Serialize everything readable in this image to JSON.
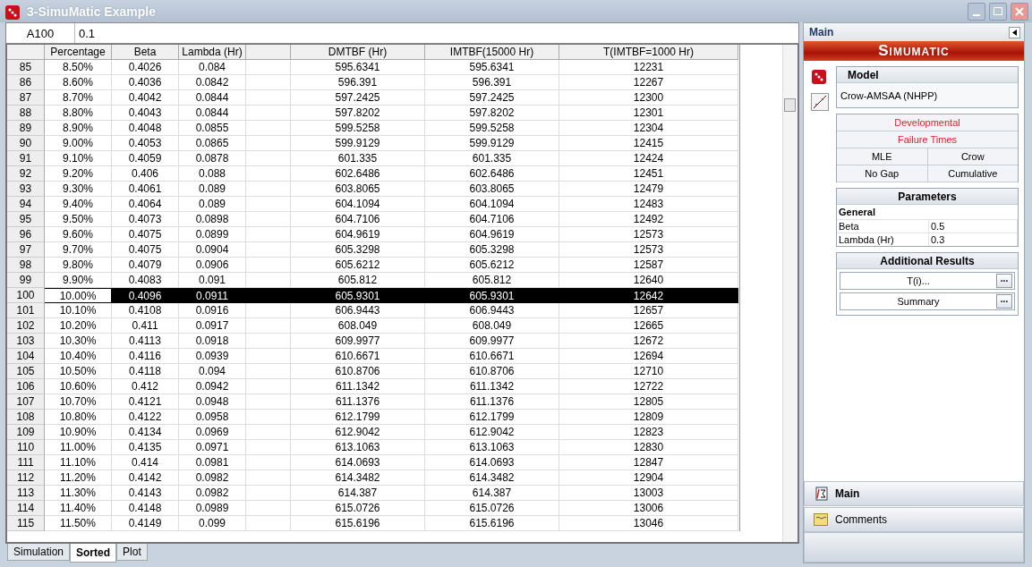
{
  "window": {
    "title": "3-SimuMatic Example"
  },
  "cell_ref": {
    "name": "A100",
    "value": "0.1"
  },
  "table": {
    "columns": [
      "Percentage",
      "Beta",
      "Lambda (Hr)",
      "DMTBF (Hr)",
      "IMTBF(15000 Hr)",
      "T(IMTBF=1000 Hr)"
    ],
    "rows": [
      {
        "id": "85",
        "cells": [
          "8.50%",
          "0.4026",
          "0.084",
          "595.6341",
          "595.6341",
          "12231"
        ],
        "selected": false
      },
      {
        "id": "86",
        "cells": [
          "8.60%",
          "0.4036",
          "0.0842",
          "596.391",
          "596.391",
          "12267"
        ],
        "selected": false
      },
      {
        "id": "87",
        "cells": [
          "8.70%",
          "0.4042",
          "0.0844",
          "597.2425",
          "597.2425",
          "12300"
        ],
        "selected": false
      },
      {
        "id": "88",
        "cells": [
          "8.80%",
          "0.4043",
          "0.0844",
          "597.8202",
          "597.8202",
          "12301"
        ],
        "selected": false
      },
      {
        "id": "89",
        "cells": [
          "8.90%",
          "0.4048",
          "0.0855",
          "599.5258",
          "599.5258",
          "12304"
        ],
        "selected": false
      },
      {
        "id": "90",
        "cells": [
          "9.00%",
          "0.4053",
          "0.0865",
          "599.9129",
          "599.9129",
          "12415"
        ],
        "selected": false
      },
      {
        "id": "91",
        "cells": [
          "9.10%",
          "0.4059",
          "0.0878",
          "601.335",
          "601.335",
          "12424"
        ],
        "selected": false
      },
      {
        "id": "92",
        "cells": [
          "9.20%",
          "0.406",
          "0.088",
          "602.6486",
          "602.6486",
          "12451"
        ],
        "selected": false
      },
      {
        "id": "93",
        "cells": [
          "9.30%",
          "0.4061",
          "0.089",
          "603.8065",
          "603.8065",
          "12479"
        ],
        "selected": false
      },
      {
        "id": "94",
        "cells": [
          "9.40%",
          "0.4064",
          "0.089",
          "604.1094",
          "604.1094",
          "12483"
        ],
        "selected": false
      },
      {
        "id": "95",
        "cells": [
          "9.50%",
          "0.4073",
          "0.0898",
          "604.7106",
          "604.7106",
          "12492"
        ],
        "selected": false
      },
      {
        "id": "96",
        "cells": [
          "9.60%",
          "0.4075",
          "0.0899",
          "604.9619",
          "604.9619",
          "12573"
        ],
        "selected": false
      },
      {
        "id": "97",
        "cells": [
          "9.70%",
          "0.4075",
          "0.0904",
          "605.3298",
          "605.3298",
          "12573"
        ],
        "selected": false
      },
      {
        "id": "98",
        "cells": [
          "9.80%",
          "0.4079",
          "0.0906",
          "605.6212",
          "605.6212",
          "12587"
        ],
        "selected": false
      },
      {
        "id": "99",
        "cells": [
          "9.90%",
          "0.4083",
          "0.091",
          "605.812",
          "605.812",
          "12640"
        ],
        "selected": false
      },
      {
        "id": "100",
        "cells": [
          "10.00%",
          "0.4096",
          "0.0911",
          "605.9301",
          "605.9301",
          "12642"
        ],
        "selected": true
      },
      {
        "id": "101",
        "cells": [
          "10.10%",
          "0.4108",
          "0.0916",
          "606.9443",
          "606.9443",
          "12657"
        ],
        "selected": false
      },
      {
        "id": "102",
        "cells": [
          "10.20%",
          "0.411",
          "0.0917",
          "608.049",
          "608.049",
          "12665"
        ],
        "selected": false
      },
      {
        "id": "103",
        "cells": [
          "10.30%",
          "0.4113",
          "0.0918",
          "609.9977",
          "609.9977",
          "12672"
        ],
        "selected": false
      },
      {
        "id": "104",
        "cells": [
          "10.40%",
          "0.4116",
          "0.0939",
          "610.6671",
          "610.6671",
          "12694"
        ],
        "selected": false
      },
      {
        "id": "105",
        "cells": [
          "10.50%",
          "0.4118",
          "0.094",
          "610.8706",
          "610.8706",
          "12710"
        ],
        "selected": false
      },
      {
        "id": "106",
        "cells": [
          "10.60%",
          "0.412",
          "0.0942",
          "611.1342",
          "611.1342",
          "12722"
        ],
        "selected": false
      },
      {
        "id": "107",
        "cells": [
          "10.70%",
          "0.4121",
          "0.0948",
          "611.1376",
          "611.1376",
          "12805"
        ],
        "selected": false
      },
      {
        "id": "108",
        "cells": [
          "10.80%",
          "0.4122",
          "0.0958",
          "612.1799",
          "612.1799",
          "12809"
        ],
        "selected": false
      },
      {
        "id": "109",
        "cells": [
          "10.90%",
          "0.4134",
          "0.0969",
          "612.9042",
          "612.9042",
          "12823"
        ],
        "selected": false
      },
      {
        "id": "110",
        "cells": [
          "11.00%",
          "0.4135",
          "0.0971",
          "613.1063",
          "613.1063",
          "12830"
        ],
        "selected": false
      },
      {
        "id": "111",
        "cells": [
          "11.10%",
          "0.414",
          "0.0981",
          "614.0693",
          "614.0693",
          "12847"
        ],
        "selected": false
      },
      {
        "id": "112",
        "cells": [
          "11.20%",
          "0.4142",
          "0.0982",
          "614.3482",
          "614.3482",
          "12904"
        ],
        "selected": false
      },
      {
        "id": "113",
        "cells": [
          "11.30%",
          "0.4143",
          "0.0982",
          "614.387",
          "614.387",
          "13003"
        ],
        "selected": false
      },
      {
        "id": "114",
        "cells": [
          "11.40%",
          "0.4148",
          "0.0989",
          "615.0726",
          "615.0726",
          "13006"
        ],
        "selected": false
      },
      {
        "id": "115",
        "cells": [
          "11.50%",
          "0.4149",
          "0.099",
          "615.6196",
          "615.6196",
          "13046"
        ],
        "selected": false
      }
    ]
  },
  "sheet_tabs": [
    {
      "label": "Simulation",
      "selected": false
    },
    {
      "label": "Sorted",
      "selected": true
    },
    {
      "label": "Plot",
      "selected": false
    }
  ],
  "panel": {
    "title": "Main",
    "banner": "Simumatic",
    "model": {
      "title": "Model",
      "value": "Crow-AMSAA (NHPP)"
    },
    "options": [
      [
        {
          "label": "Developmental",
          "color": "#e8202a"
        }
      ],
      [
        {
          "label": "Failure Times",
          "color": "#e8202a"
        }
      ],
      [
        {
          "label": "MLE",
          "color": "#000000"
        },
        {
          "label": "Crow",
          "color": "#000000"
        }
      ],
      [
        {
          "label": "No Gap",
          "color": "#000000"
        },
        {
          "label": "Cumulative",
          "color": "#000000"
        }
      ]
    ],
    "parameters": {
      "title": "Parameters",
      "group": "General",
      "rows": [
        {
          "name": "Beta",
          "value": "0.5"
        },
        {
          "name": "Lambda (Hr)",
          "value": "0.3"
        }
      ]
    },
    "additional": {
      "title": "Additional Results",
      "buttons": [
        {
          "label": "T(i)...",
          "action": "..."
        },
        {
          "label": "Summary",
          "action": "..."
        }
      ]
    },
    "nav": [
      {
        "label": "Main",
        "kind": "main",
        "selected": true
      },
      {
        "label": "Comments",
        "kind": "comments",
        "selected": false
      }
    ]
  }
}
